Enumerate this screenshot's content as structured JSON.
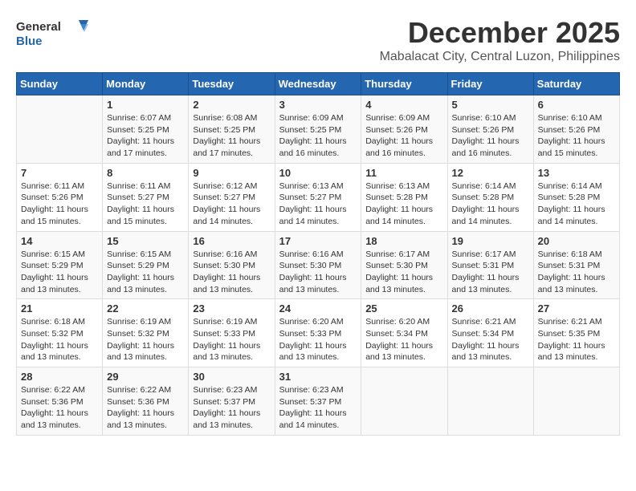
{
  "logo": {
    "general": "General",
    "blue": "Blue"
  },
  "title": {
    "month": "December 2025",
    "location": "Mabalacat City, Central Luzon, Philippines"
  },
  "headers": [
    "Sunday",
    "Monday",
    "Tuesday",
    "Wednesday",
    "Thursday",
    "Friday",
    "Saturday"
  ],
  "weeks": [
    [
      {
        "day": "",
        "sunrise": "",
        "sunset": "",
        "daylight": ""
      },
      {
        "day": "1",
        "sunrise": "Sunrise: 6:07 AM",
        "sunset": "Sunset: 5:25 PM",
        "daylight": "Daylight: 11 hours and 17 minutes."
      },
      {
        "day": "2",
        "sunrise": "Sunrise: 6:08 AM",
        "sunset": "Sunset: 5:25 PM",
        "daylight": "Daylight: 11 hours and 17 minutes."
      },
      {
        "day": "3",
        "sunrise": "Sunrise: 6:09 AM",
        "sunset": "Sunset: 5:25 PM",
        "daylight": "Daylight: 11 hours and 16 minutes."
      },
      {
        "day": "4",
        "sunrise": "Sunrise: 6:09 AM",
        "sunset": "Sunset: 5:26 PM",
        "daylight": "Daylight: 11 hours and 16 minutes."
      },
      {
        "day": "5",
        "sunrise": "Sunrise: 6:10 AM",
        "sunset": "Sunset: 5:26 PM",
        "daylight": "Daylight: 11 hours and 16 minutes."
      },
      {
        "day": "6",
        "sunrise": "Sunrise: 6:10 AM",
        "sunset": "Sunset: 5:26 PM",
        "daylight": "Daylight: 11 hours and 15 minutes."
      }
    ],
    [
      {
        "day": "7",
        "sunrise": "Sunrise: 6:11 AM",
        "sunset": "Sunset: 5:26 PM",
        "daylight": "Daylight: 11 hours and 15 minutes."
      },
      {
        "day": "8",
        "sunrise": "Sunrise: 6:11 AM",
        "sunset": "Sunset: 5:27 PM",
        "daylight": "Daylight: 11 hours and 15 minutes."
      },
      {
        "day": "9",
        "sunrise": "Sunrise: 6:12 AM",
        "sunset": "Sunset: 5:27 PM",
        "daylight": "Daylight: 11 hours and 14 minutes."
      },
      {
        "day": "10",
        "sunrise": "Sunrise: 6:13 AM",
        "sunset": "Sunset: 5:27 PM",
        "daylight": "Daylight: 11 hours and 14 minutes."
      },
      {
        "day": "11",
        "sunrise": "Sunrise: 6:13 AM",
        "sunset": "Sunset: 5:28 PM",
        "daylight": "Daylight: 11 hours and 14 minutes."
      },
      {
        "day": "12",
        "sunrise": "Sunrise: 6:14 AM",
        "sunset": "Sunset: 5:28 PM",
        "daylight": "Daylight: 11 hours and 14 minutes."
      },
      {
        "day": "13",
        "sunrise": "Sunrise: 6:14 AM",
        "sunset": "Sunset: 5:28 PM",
        "daylight": "Daylight: 11 hours and 14 minutes."
      }
    ],
    [
      {
        "day": "14",
        "sunrise": "Sunrise: 6:15 AM",
        "sunset": "Sunset: 5:29 PM",
        "daylight": "Daylight: 11 hours and 13 minutes."
      },
      {
        "day": "15",
        "sunrise": "Sunrise: 6:15 AM",
        "sunset": "Sunset: 5:29 PM",
        "daylight": "Daylight: 11 hours and 13 minutes."
      },
      {
        "day": "16",
        "sunrise": "Sunrise: 6:16 AM",
        "sunset": "Sunset: 5:30 PM",
        "daylight": "Daylight: 11 hours and 13 minutes."
      },
      {
        "day": "17",
        "sunrise": "Sunrise: 6:16 AM",
        "sunset": "Sunset: 5:30 PM",
        "daylight": "Daylight: 11 hours and 13 minutes."
      },
      {
        "day": "18",
        "sunrise": "Sunrise: 6:17 AM",
        "sunset": "Sunset: 5:30 PM",
        "daylight": "Daylight: 11 hours and 13 minutes."
      },
      {
        "day": "19",
        "sunrise": "Sunrise: 6:17 AM",
        "sunset": "Sunset: 5:31 PM",
        "daylight": "Daylight: 11 hours and 13 minutes."
      },
      {
        "day": "20",
        "sunrise": "Sunrise: 6:18 AM",
        "sunset": "Sunset: 5:31 PM",
        "daylight": "Daylight: 11 hours and 13 minutes."
      }
    ],
    [
      {
        "day": "21",
        "sunrise": "Sunrise: 6:18 AM",
        "sunset": "Sunset: 5:32 PM",
        "daylight": "Daylight: 11 hours and 13 minutes."
      },
      {
        "day": "22",
        "sunrise": "Sunrise: 6:19 AM",
        "sunset": "Sunset: 5:32 PM",
        "daylight": "Daylight: 11 hours and 13 minutes."
      },
      {
        "day": "23",
        "sunrise": "Sunrise: 6:19 AM",
        "sunset": "Sunset: 5:33 PM",
        "daylight": "Daylight: 11 hours and 13 minutes."
      },
      {
        "day": "24",
        "sunrise": "Sunrise: 6:20 AM",
        "sunset": "Sunset: 5:33 PM",
        "daylight": "Daylight: 11 hours and 13 minutes."
      },
      {
        "day": "25",
        "sunrise": "Sunrise: 6:20 AM",
        "sunset": "Sunset: 5:34 PM",
        "daylight": "Daylight: 11 hours and 13 minutes."
      },
      {
        "day": "26",
        "sunrise": "Sunrise: 6:21 AM",
        "sunset": "Sunset: 5:34 PM",
        "daylight": "Daylight: 11 hours and 13 minutes."
      },
      {
        "day": "27",
        "sunrise": "Sunrise: 6:21 AM",
        "sunset": "Sunset: 5:35 PM",
        "daylight": "Daylight: 11 hours and 13 minutes."
      }
    ],
    [
      {
        "day": "28",
        "sunrise": "Sunrise: 6:22 AM",
        "sunset": "Sunset: 5:36 PM",
        "daylight": "Daylight: 11 hours and 13 minutes."
      },
      {
        "day": "29",
        "sunrise": "Sunrise: 6:22 AM",
        "sunset": "Sunset: 5:36 PM",
        "daylight": "Daylight: 11 hours and 13 minutes."
      },
      {
        "day": "30",
        "sunrise": "Sunrise: 6:23 AM",
        "sunset": "Sunset: 5:37 PM",
        "daylight": "Daylight: 11 hours and 13 minutes."
      },
      {
        "day": "31",
        "sunrise": "Sunrise: 6:23 AM",
        "sunset": "Sunset: 5:37 PM",
        "daylight": "Daylight: 11 hours and 14 minutes."
      },
      {
        "day": "",
        "sunrise": "",
        "sunset": "",
        "daylight": ""
      },
      {
        "day": "",
        "sunrise": "",
        "sunset": "",
        "daylight": ""
      },
      {
        "day": "",
        "sunrise": "",
        "sunset": "",
        "daylight": ""
      }
    ]
  ]
}
